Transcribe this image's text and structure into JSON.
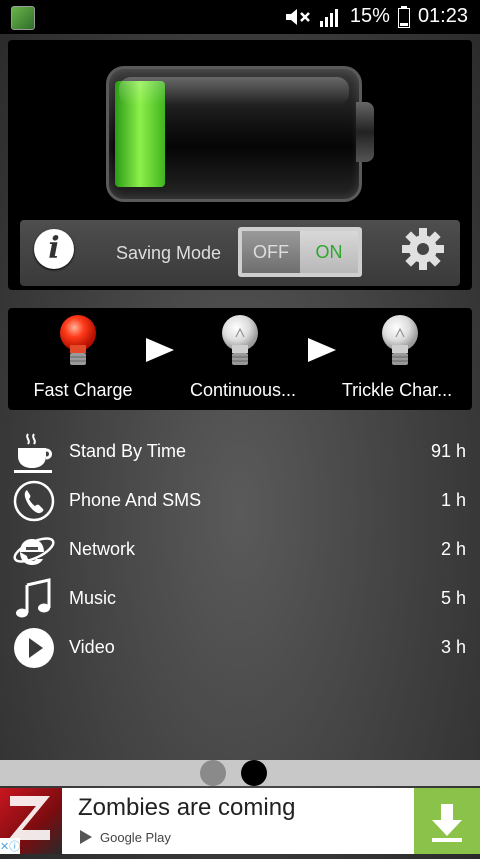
{
  "status_bar": {
    "battery_percent": "15%",
    "time": "01:23",
    "icons": [
      "app-icon",
      "mute-icon",
      "signal-icon",
      "battery-icon"
    ]
  },
  "battery": {
    "charge_fraction": 0.15,
    "fill_color": "#59d12c"
  },
  "controls": {
    "info_icon_glyph": "i",
    "saving_mode_label": "Saving Mode",
    "toggle_off": "OFF",
    "toggle_on": "ON",
    "toggle_state": "on"
  },
  "charge_stages": [
    {
      "label": "Fast Charge",
      "active": true
    },
    {
      "label": "Continuous...",
      "active": false
    },
    {
      "label": "Trickle Char...",
      "active": false
    }
  ],
  "usage": [
    {
      "icon": "coffee-cup-icon",
      "label": "Stand By Time",
      "value": "91 h"
    },
    {
      "icon": "phone-icon",
      "label": "Phone And SMS",
      "value": "1 h"
    },
    {
      "icon": "internet-explorer-icon",
      "label": "Network",
      "value": "2 h"
    },
    {
      "icon": "music-note-icon",
      "label": "Music",
      "value": "5 h"
    },
    {
      "icon": "play-icon",
      "label": "Video",
      "value": "3 h"
    }
  ],
  "pager": {
    "pages": 2,
    "current": 2
  },
  "ad": {
    "title": "Zombies are coming",
    "store": "Google Play",
    "button_icon": "download-icon"
  }
}
